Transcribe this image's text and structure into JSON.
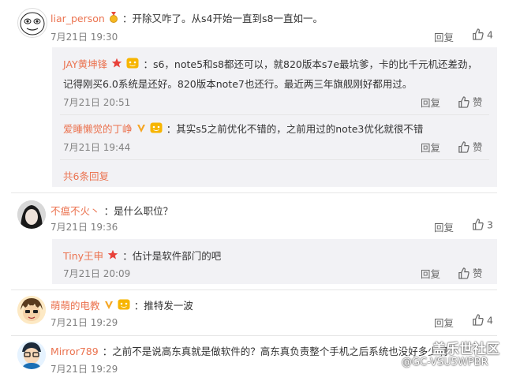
{
  "comments": [
    {
      "user": "liar_person",
      "text": "：开除又咋了。从s4开始一直到s8一直如一。",
      "time": "7月21日 19:30",
      "reply": "回复",
      "likes": "4"
    },
    {
      "user": "不瘟不火丶",
      "text": "：是什么职位？",
      "time": "7月21日 19:36",
      "reply": "回复",
      "likes": "3"
    },
    {
      "user": "萌萌的电教",
      "text": "：推特发一波",
      "time": "7月21日 19:29",
      "reply": "回复",
      "likes": "4"
    },
    {
      "user": "Mirror789",
      "text": "：之前不是说高东真就是做软件的？高东真负责整个手机之后系统也没好多少啊",
      "time": "7月21日 19:29",
      "reply": "回复",
      "likes": ""
    }
  ],
  "replies": [
    {
      "user": "JAY黄坤锋",
      "line1": "：s6，note5和s8都还可以，就820版本s7e最坑爹，卡的比千元机还差劲，",
      "line2": "记得刚买6.0系统是还好。820版本note7也还行。最近两三年旗舰刚好都用过。",
      "time": "7月21日 20:51",
      "reply": "回复",
      "like": "赞"
    },
    {
      "user": "爱睡懒觉的丁峥",
      "line1": "：其实s5之前优化不错的，之前用过的note3优化就很不错",
      "time": "7月21日 19:44",
      "reply": "回复",
      "like": "赞"
    },
    {
      "user": "Tiny王申",
      "line1": "：估计是软件部门的吧",
      "time": "7月21日 20:09",
      "reply": "回复",
      "like": "赞"
    }
  ],
  "more_replies": "共6条回复",
  "watermark": {
    "main": "盖乐世社区",
    "sub": "@GC-VSU5WPBR"
  },
  "colors": {
    "name": "#eb7350",
    "subbox": "#f2f2f5",
    "divider": "#e6e6e6"
  },
  "icons": [
    "gold-medal-icon",
    "star-badge-icon",
    "vip-badge-icon",
    "thumbs-up-icon"
  ]
}
